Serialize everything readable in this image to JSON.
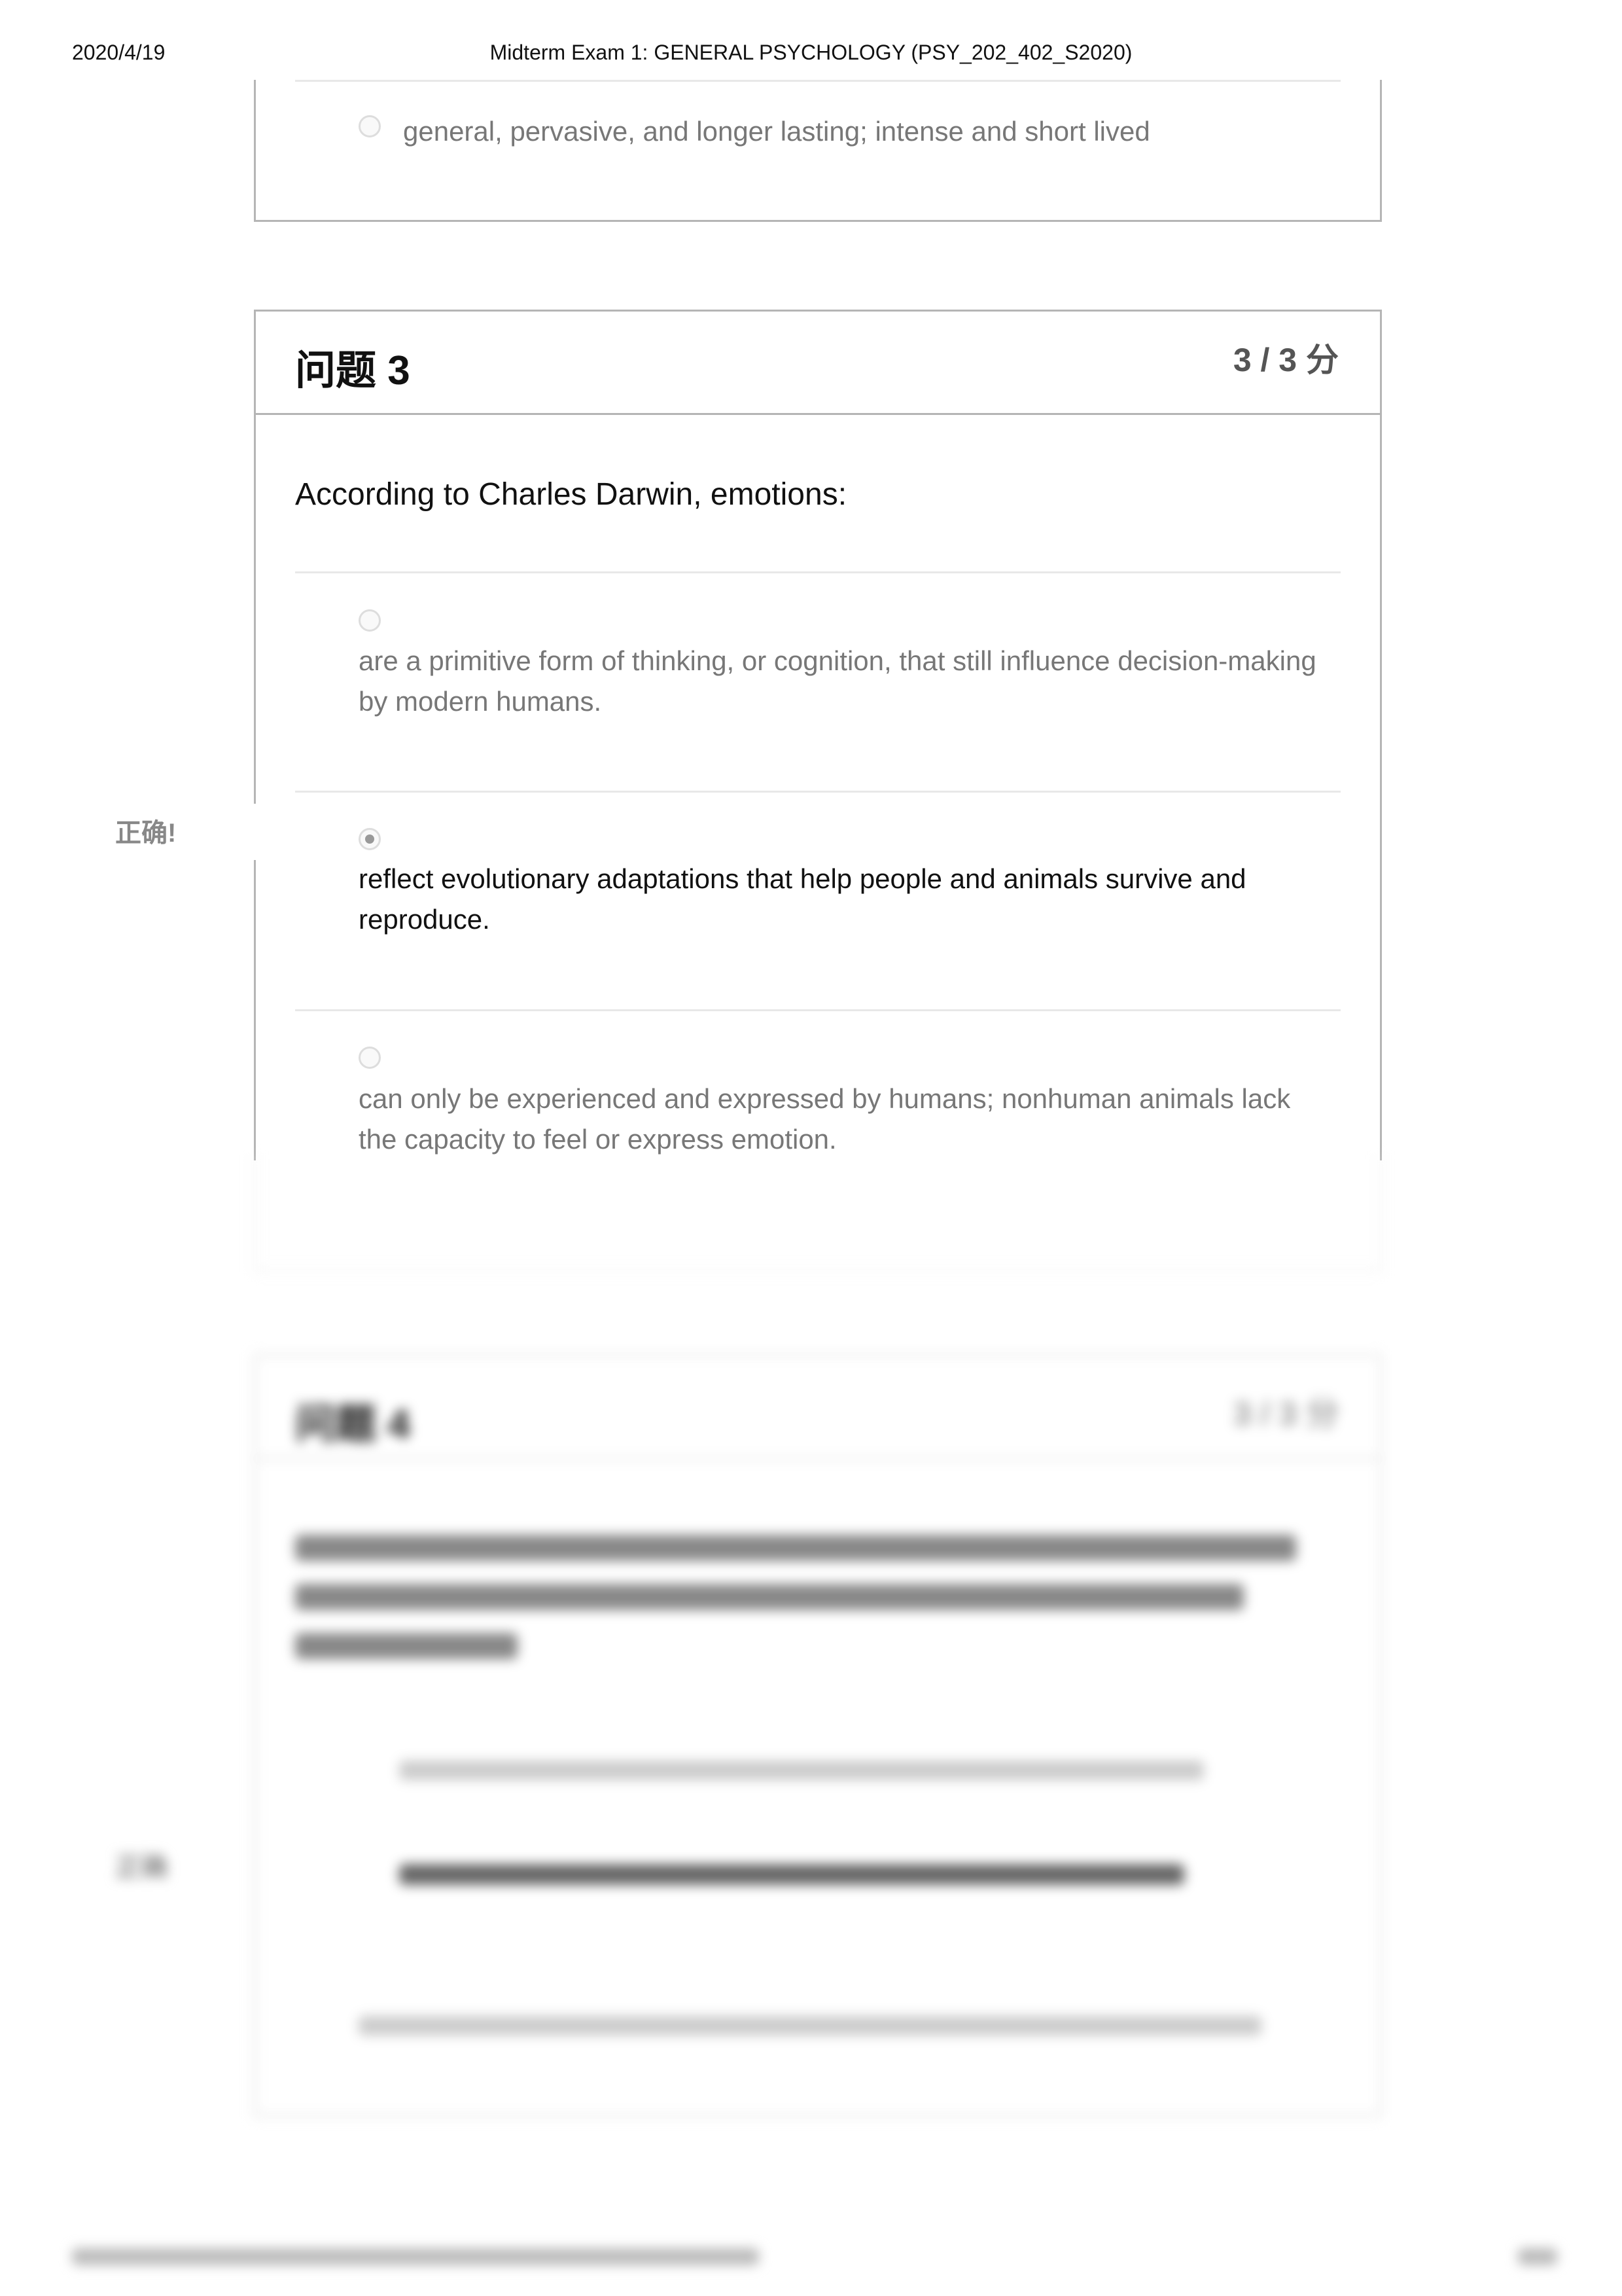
{
  "header": {
    "date": "2020/4/19",
    "title": "Midterm Exam 1: GENERAL PSYCHOLOGY (PSY_202_402_S2020)"
  },
  "previous_question": {
    "option": "general, pervasive, and longer lasting;    intense and short lived",
    "selected": false
  },
  "question3": {
    "title": "问题 3",
    "score": "3 / 3 分",
    "text": "According to Charles Darwin, emotions:",
    "correct_label": "正确!",
    "options": [
      {
        "text": "are a primitive form of thinking, or cognition, that still influence decision-making by modern humans.",
        "selected": false
      },
      {
        "text": "reflect evolutionary adaptations that help people and animals survive and reproduce.",
        "selected": true
      },
      {
        "text": "can only be experienced and expressed by humans; nonhuman animals lack the capacity to feel or express emotion.",
        "selected": false
      }
    ]
  },
  "question4": {
    "title": "问题 4",
    "score": "3 / 3 分",
    "correct_label": "正确"
  }
}
